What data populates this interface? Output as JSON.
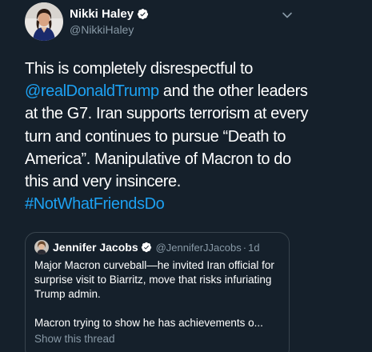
{
  "colors": {
    "background": "#15202b",
    "text": "#ffffff",
    "secondary_text": "#8899a6",
    "link": "#1da1f2",
    "border": "#38444d",
    "verified": "#ffffff"
  },
  "tweet": {
    "author_name": "Nikki Haley",
    "author_handle": "@NikkiHaley",
    "verified": true,
    "avatar_icon": "profile-photo",
    "menu_icon": "chevron-down-icon",
    "text": {
      "part1": "This is completely disrespectful to ",
      "mention": "@realDonaldTrump",
      "part2": " and the other leaders at the G7. Iran supports terrorism at every turn and continues to pursue “Death to America”. Manipulative of Macron to do this and very insincere. ",
      "hashtag": "#NotWhatFriendsDo"
    }
  },
  "quoted_tweet": {
    "author_name": "Jennifer Jacobs",
    "author_handle": "@JenniferJJacobs",
    "separator": "·",
    "time": "1d",
    "verified": true,
    "body": "Major Macron curveball—he invited Iran official for surprise visit to Biarritz, move that risks infuriating Trump admin.",
    "body2": "Macron trying to show he has achievements o...",
    "show_thread": "Show this thread"
  }
}
